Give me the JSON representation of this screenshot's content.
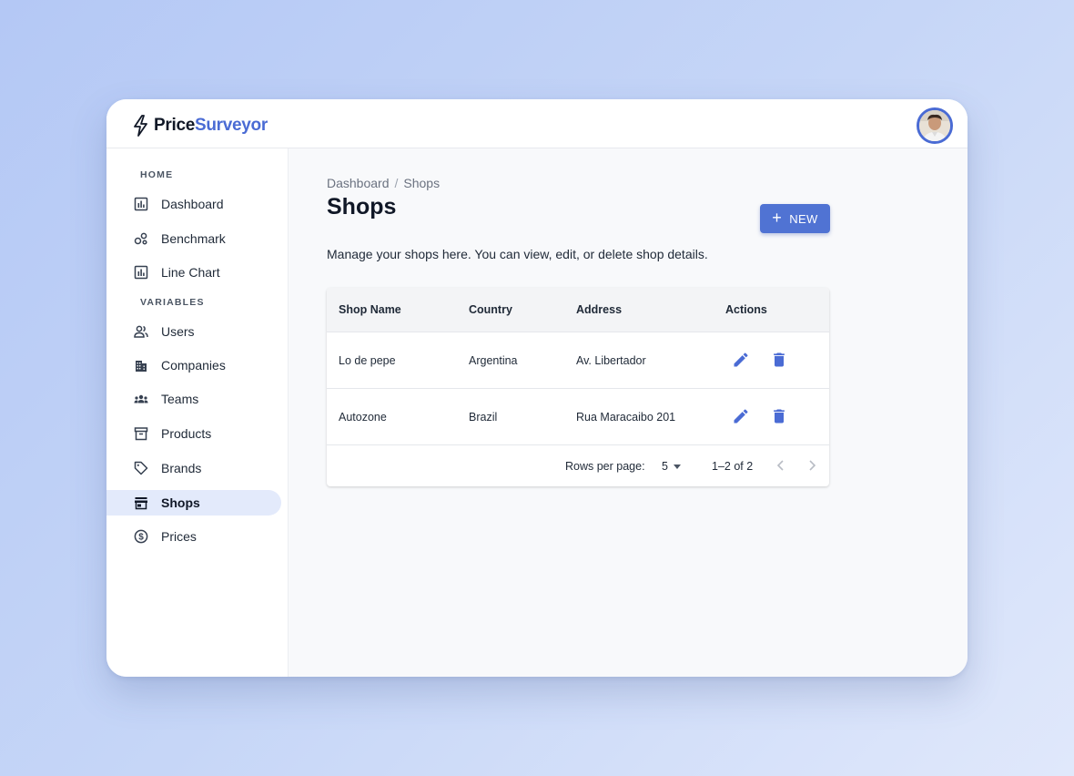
{
  "app": {
    "logo_part1": "Price",
    "logo_part2": "Surveyor"
  },
  "sidebar": {
    "sections": [
      {
        "label": "HOME",
        "items": [
          {
            "label": "Dashboard",
            "icon": "bar-chart-icon"
          },
          {
            "label": "Benchmark",
            "icon": "bubbles-icon"
          },
          {
            "label": "Line Chart",
            "icon": "bar-chart-icon"
          }
        ]
      },
      {
        "label": "VARIABLES",
        "items": [
          {
            "label": "Users",
            "icon": "users-icon"
          },
          {
            "label": "Companies",
            "icon": "building-icon"
          },
          {
            "label": "Teams",
            "icon": "groups-icon"
          },
          {
            "label": "Products",
            "icon": "archive-box-icon"
          },
          {
            "label": "Brands",
            "icon": "tag-icon"
          },
          {
            "label": "Shops",
            "icon": "store-icon",
            "active": true
          },
          {
            "label": "Prices",
            "icon": "dollar-circle-icon"
          }
        ]
      }
    ]
  },
  "main": {
    "breadcrumb": [
      "Dashboard",
      "Shops"
    ],
    "breadcrumb_separator": "/",
    "title": "Shops",
    "new_button_label": "NEW",
    "description": "Manage your shops here. You can view, edit, or delete shop details."
  },
  "table": {
    "columns": [
      "Shop Name",
      "Country",
      "Address",
      "Actions"
    ],
    "rows": [
      {
        "name": "Lo de pepe",
        "country": "Argentina",
        "address": "Av. Libertador"
      },
      {
        "name": "Autozone",
        "country": "Brazil",
        "address": "Rua Maracaibo 201"
      }
    ],
    "pagination": {
      "rows_per_page_label": "Rows per page:",
      "rows_per_page": "5",
      "range": "1–2 of 2"
    }
  },
  "colors": {
    "accent": "#4a6bd4",
    "button": "#5073d3",
    "active_nav_bg": "#e3eafb",
    "background_from": "#b4c8f5",
    "background_to": "#e0e8fb"
  }
}
